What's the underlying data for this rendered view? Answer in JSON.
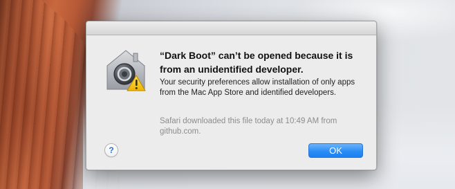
{
  "dialog": {
    "title": "“Dark Boot” can’t be opened because it is from an unidentified developer.",
    "message": "Your security preferences allow installation of only apps from the Mac App Store and identified developers.",
    "info": "Safari downloaded this file today at 10:49 AM from github.com.",
    "help_label": "?",
    "ok_label": "OK",
    "icon": "gatekeeper-warning-icon"
  },
  "colors": {
    "accent": "#2b8ef5",
    "warning": "#f2c000"
  }
}
